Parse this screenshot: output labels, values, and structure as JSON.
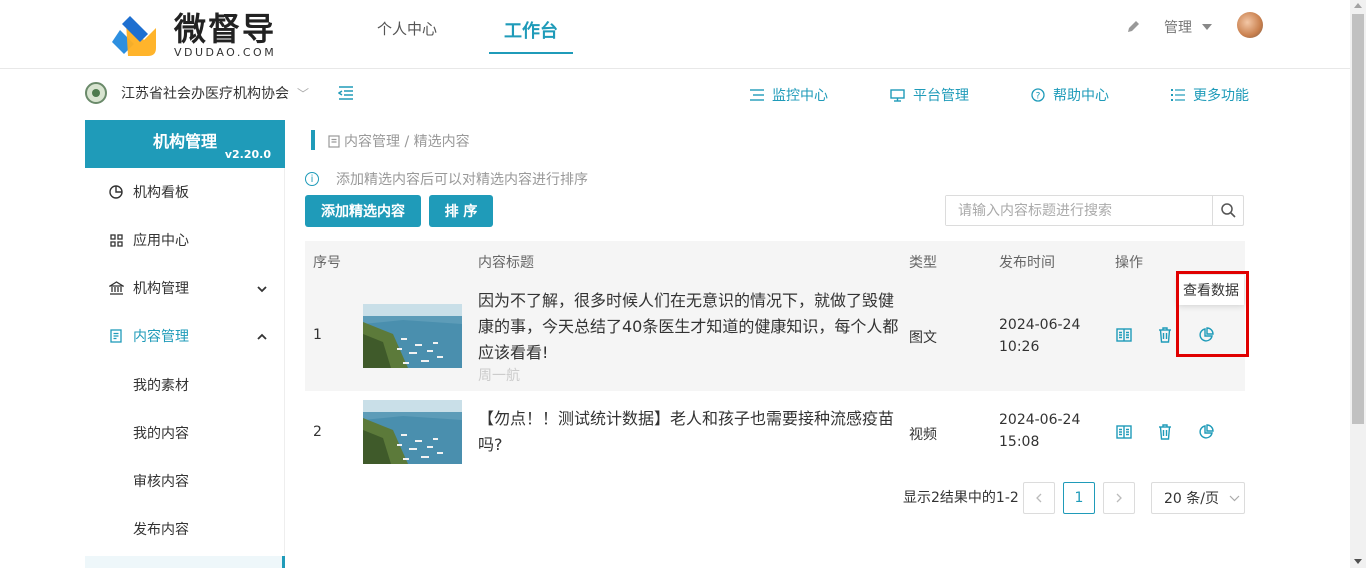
{
  "header": {
    "logo_cn": "微督导",
    "logo_en": "VDUDAO.COM",
    "nav": [
      {
        "label": "个人中心"
      },
      {
        "label": "工作台"
      }
    ],
    "user_label": "管理"
  },
  "org": {
    "name": "江苏省社会办医疗机构协会"
  },
  "toolnav": [
    {
      "label": "监控中心",
      "icon": "monitor-list-icon"
    },
    {
      "label": "平台管理",
      "icon": "desktop-icon"
    },
    {
      "label": "帮助中心",
      "icon": "help-circle-icon"
    },
    {
      "label": "更多功能",
      "icon": "menu-list-icon"
    }
  ],
  "sidebar": {
    "title": "机构管理",
    "version": "v2.20.0",
    "items": [
      {
        "label": "机构看板"
      },
      {
        "label": "应用中心"
      },
      {
        "label": "机构管理"
      },
      {
        "label": "内容管理"
      }
    ],
    "sub_items": [
      {
        "label": "我的素材"
      },
      {
        "label": "我的内容"
      },
      {
        "label": "审核内容"
      },
      {
        "label": "发布内容"
      }
    ]
  },
  "breadcrumb": "内容管理 / 精选内容",
  "tip": "添加精选内容后可以对精选内容进行排序",
  "buttons": {
    "add": "添加精选内容",
    "sort": "排 序"
  },
  "search": {
    "placeholder": "请输入内容标题进行搜索"
  },
  "table": {
    "headers": {
      "index": "序号",
      "title": "内容标题",
      "type": "类型",
      "time": "发布时间",
      "ops": "操作"
    },
    "rows": [
      {
        "index": "1",
        "title": "因为不了解，很多时候人们在无意识的情况下，就做了毁健康的事，今天总结了40条医生才知道的健康知识，每个人都应该看看!",
        "author": "周一航",
        "type": "图文",
        "date": "2024-06-24",
        "time": "10:26"
      },
      {
        "index": "2",
        "title": "【勿点！！测试统计数据】老人和孩子也需要接种流感疫苗吗?",
        "type": "视频",
        "date": "2024-06-24",
        "time": "15:08"
      }
    ]
  },
  "tooltip": "查看数据",
  "pagination": {
    "summary": "显示2结果中的1-2",
    "current_page": "1",
    "page_size": "20 条/页"
  },
  "colors": {
    "accent": "#1f9bb9",
    "highlight": "#e00000"
  }
}
